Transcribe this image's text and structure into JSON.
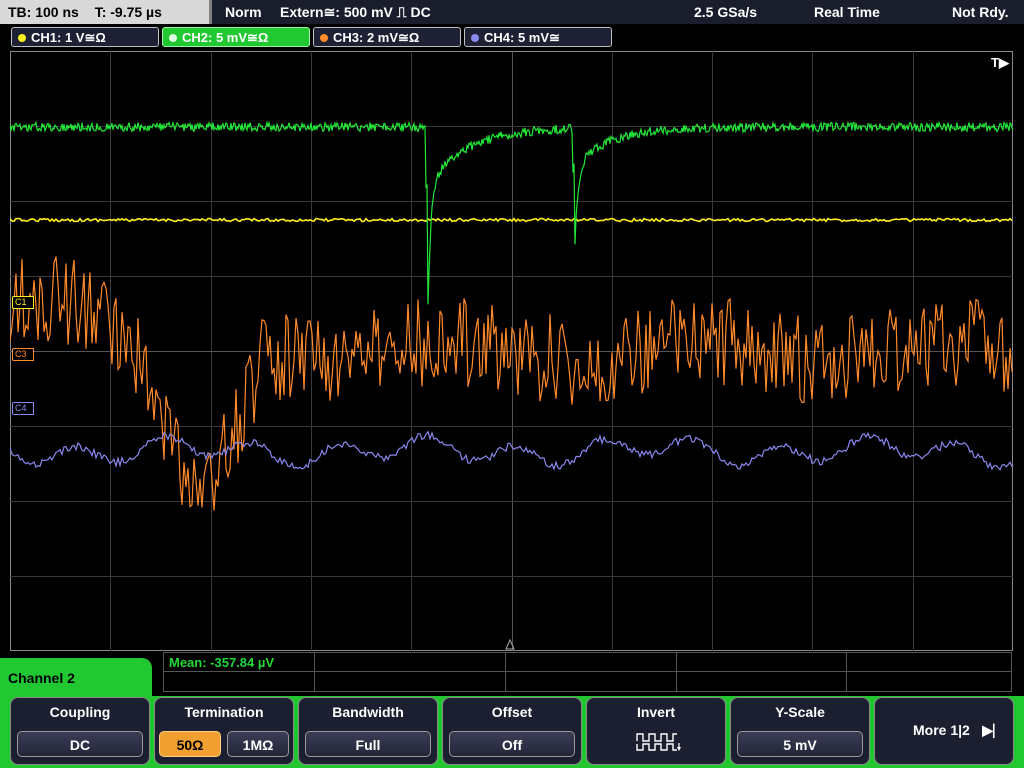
{
  "top_bar": {
    "timebase": "TB: 100 ns",
    "trigger_time": "T: -9.75 µs",
    "acq_mode": "Norm",
    "trigger_source": "Extern≅: 500 mV ⎍ DC",
    "sample_rate": "2.5 GSa/s",
    "acq_type": "Real Time",
    "status": "Not Rdy."
  },
  "channels": [
    {
      "label": "CH1: 1 V≅Ω",
      "color": "#ffee22",
      "active": false
    },
    {
      "label": "CH2: 5 mV≅Ω",
      "color": "#22e838",
      "active": true
    },
    {
      "label": "CH3: 2 mV≅Ω",
      "color": "#ff8a2a",
      "active": false
    },
    {
      "label": "CH4: 5 mV≅",
      "color": "#8a88ee",
      "active": false
    }
  ],
  "markers": {
    "ch1": "C1",
    "ch3": "C3",
    "ch4": "C4",
    "trigger": "T▶"
  },
  "measurement": {
    "label": "Mean: -357.84 µV"
  },
  "menu": {
    "title": "Channel 2",
    "coupling": {
      "title": "Coupling",
      "value": "DC"
    },
    "termination": {
      "title": "Termination",
      "opt1": "50Ω",
      "opt2": "1MΩ"
    },
    "bandwidth": {
      "title": "Bandwidth",
      "value": "Full"
    },
    "offset": {
      "title": "Offset",
      "value": "Off"
    },
    "invert": {
      "title": "Invert",
      "icon": "invert-waveform-icon"
    },
    "yscale": {
      "title": "Y-Scale",
      "value": "5 mV"
    },
    "more": {
      "label": "More 1|2"
    }
  },
  "colors": {
    "accent_green": "#22c832",
    "ch1": "#ffee22",
    "ch2": "#22e838",
    "ch3": "#ff8a2a",
    "ch4": "#8a88ee"
  }
}
